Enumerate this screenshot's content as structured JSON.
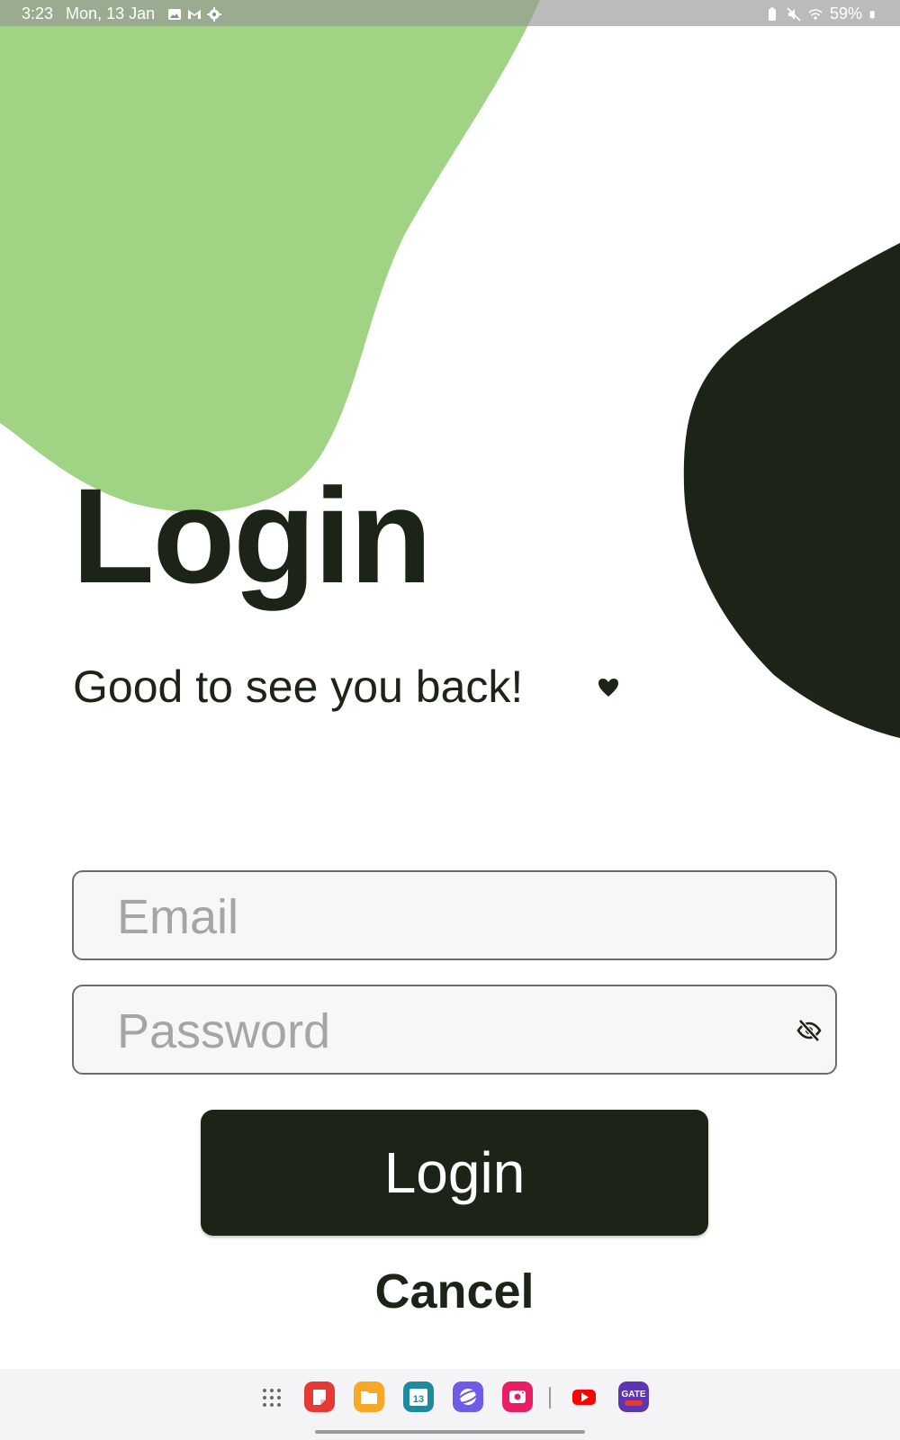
{
  "status_bar": {
    "time": "3:23",
    "date": "Mon, 13 Jan",
    "battery": "59%",
    "left_icons": [
      "gallery-icon",
      "gmail-icon",
      "settings-icon"
    ],
    "right_icons": [
      "battery-saver-icon",
      "mute-icon",
      "wifi-icon",
      "battery-icon"
    ]
  },
  "login": {
    "title": "Login",
    "subtitle": "Good to see you back!",
    "email_placeholder": "Email",
    "password_placeholder": "Password",
    "login_button": "Login",
    "cancel_button": "Cancel"
  },
  "dock": {
    "calendar_day": "13",
    "gate_label": "GATE",
    "apps": [
      "app-drawer",
      "notes",
      "my-files",
      "calendar",
      "samsung-internet",
      "screen-recorder",
      "youtube",
      "gate-2025"
    ]
  },
  "colors": {
    "accent_green": "#a0d384",
    "dark": "#1c2418",
    "background": "#ffffff"
  }
}
